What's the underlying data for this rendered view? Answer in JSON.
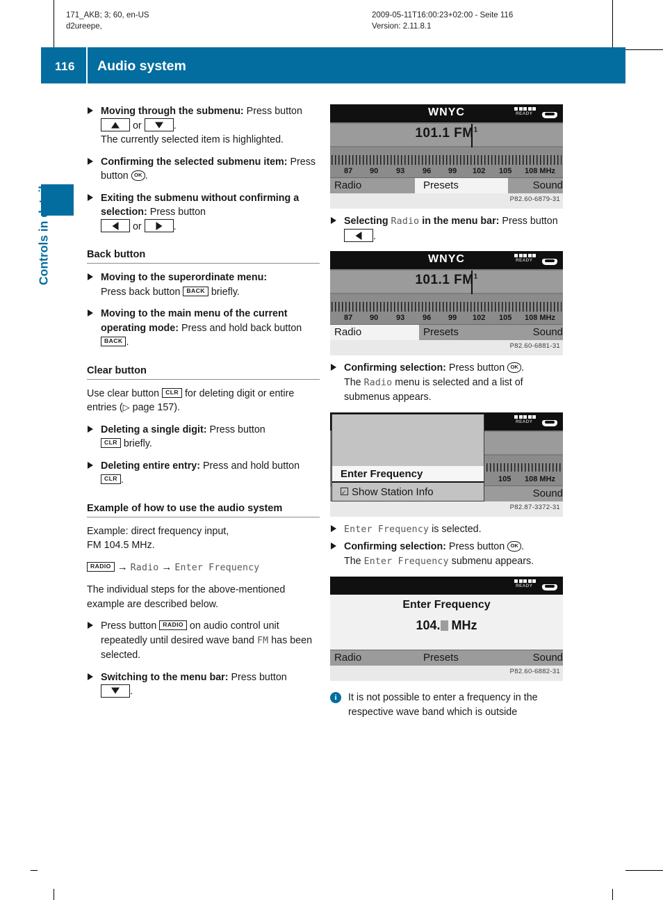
{
  "print_header": {
    "left_line1": "171_AKB; 3; 60, en-US",
    "left_line2": "d2ureepe,",
    "right_line1": "2009-05-11T16:00:23+02:00 - Seite 116",
    "right_line2": "Version: 2.11.8.1"
  },
  "banner": {
    "page_number": "116",
    "title": "Audio system",
    "color": "#046d9f"
  },
  "side_tab": {
    "label": "Controls in detail"
  },
  "left_column": {
    "b1": {
      "bold": "Moving through the submenu:",
      "t1": " Press button ",
      "key_up": "▲",
      "t2": " or ",
      "key_down": "▼",
      "t3": ".",
      "sub": "The currently selected item is highlighted."
    },
    "b2": {
      "bold": "Confirming the selected submenu item:",
      "t1": " Press button ",
      "key_ok": "OK",
      "t2": "."
    },
    "b3": {
      "bold": "Exiting the submenu without confirming a selection:",
      "t1": " Press button ",
      "key_left": "◀",
      "t2": " or ",
      "key_right": "▶",
      "t3": "."
    },
    "back_section": {
      "heading": "Back button",
      "b1": {
        "bold": "Moving to the superordinate menu:",
        "t1": " Press back button ",
        "key": "BACK",
        "t2": " briefly."
      },
      "b2": {
        "bold": "Moving to the main menu of the current operating mode:",
        "t1": " Press and hold back button ",
        "key": "BACK",
        "t2": "."
      }
    },
    "clear_section": {
      "heading": "Clear button",
      "intro": {
        "t1": "Use clear button ",
        "key": "CLR",
        "t2": " for deleting digit or entire entries (",
        "ptr": "▷",
        "t3": " page 157)."
      },
      "b1": {
        "bold": "Deleting a single digit:",
        "t1": " Press button ",
        "key": "CLR",
        "t2": " briefly."
      },
      "b2": {
        "bold": "Deleting entire entry:",
        "t1": " Press and hold button ",
        "key": "CLR",
        "t2": "."
      }
    },
    "example_section": {
      "heading": "Example of how to use the audio system",
      "p1_line1": "Example: direct frequency input,",
      "p1_line2": "FM 104.5 MHz.",
      "path": {
        "key": "RADIO",
        "arrow1": "→",
        "item1": "Radio",
        "arrow2": "→",
        "item2": "Enter Frequency"
      },
      "p2": "The individual steps for the above-mentioned example are described below.",
      "b1": {
        "t1": "Press button ",
        "key": "RADIO",
        "t2": " on audio control unit repeatedly until desired wave band ",
        "mono": "FM",
        "t3": " has been selected."
      },
      "b2": {
        "bold": "Switching to the menu bar:",
        "t1": " Press button ",
        "key_down": "▼",
        "t2": "."
      }
    }
  },
  "right_column": {
    "shot1": {
      "station": "WNYC",
      "frequency": "101.1 FM",
      "band_sup": "1",
      "status_label": "READY",
      "scale": [
        "87",
        "90",
        "93",
        "96",
        "99",
        "102",
        "105",
        "108 MHz"
      ],
      "menu": [
        "Radio",
        "Presets",
        "Sound"
      ],
      "selected_menu": "Presets",
      "caption": "P82.60-6879-31"
    },
    "b1": {
      "bold1": "Selecting ",
      "mono": "Radio",
      "bold2": " in the menu bar:",
      "t1": " Press button ",
      "key_left": "◀",
      "t2": "."
    },
    "shot2": {
      "station": "WNYC",
      "frequency": "101.1 FM",
      "band_sup": "1",
      "status_label": "READY",
      "scale": [
        "87",
        "90",
        "93",
        "96",
        "99",
        "102",
        "105",
        "108 MHz"
      ],
      "menu": [
        "Radio",
        "Presets",
        "Sound"
      ],
      "selected_menu": "Radio",
      "caption": "P82.60-6881-31"
    },
    "b2": {
      "bold": "Confirming selection:",
      "t1": " Press button ",
      "key_ok": "OK",
      "t2": ".",
      "sub1": "The ",
      "sub_mono": "Radio",
      "sub2": " menu is selected and a list of submenus appears."
    },
    "shot3": {
      "status_label": "READY",
      "overlay_items": [
        "Enter Frequency",
        "Show Station Info"
      ],
      "selected_item": "Enter Frequency",
      "checkbox_checked": true,
      "scale": [
        "105",
        "108 MHz"
      ],
      "menu_right": "Sound",
      "caption": "P82.87-3372-31"
    },
    "b3": {
      "mono": "Enter Frequency",
      "t1": " is selected."
    },
    "b4": {
      "bold": "Confirming selection:",
      "t1": " Press button ",
      "key_ok": "OK",
      "t2": ".",
      "sub1": "The ",
      "sub_mono": "Enter Frequency",
      "sub2": " submenu appears."
    },
    "shot4": {
      "status_label": "READY",
      "title": "Enter Frequency",
      "value_prefix": "104.",
      "value_unit": "MHz",
      "menu": [
        "Radio",
        "Presets",
        "Sound"
      ],
      "caption": "P82.60-6882-31"
    },
    "note": "It is not possible to enter a frequency in the respective wave band which is outside"
  }
}
